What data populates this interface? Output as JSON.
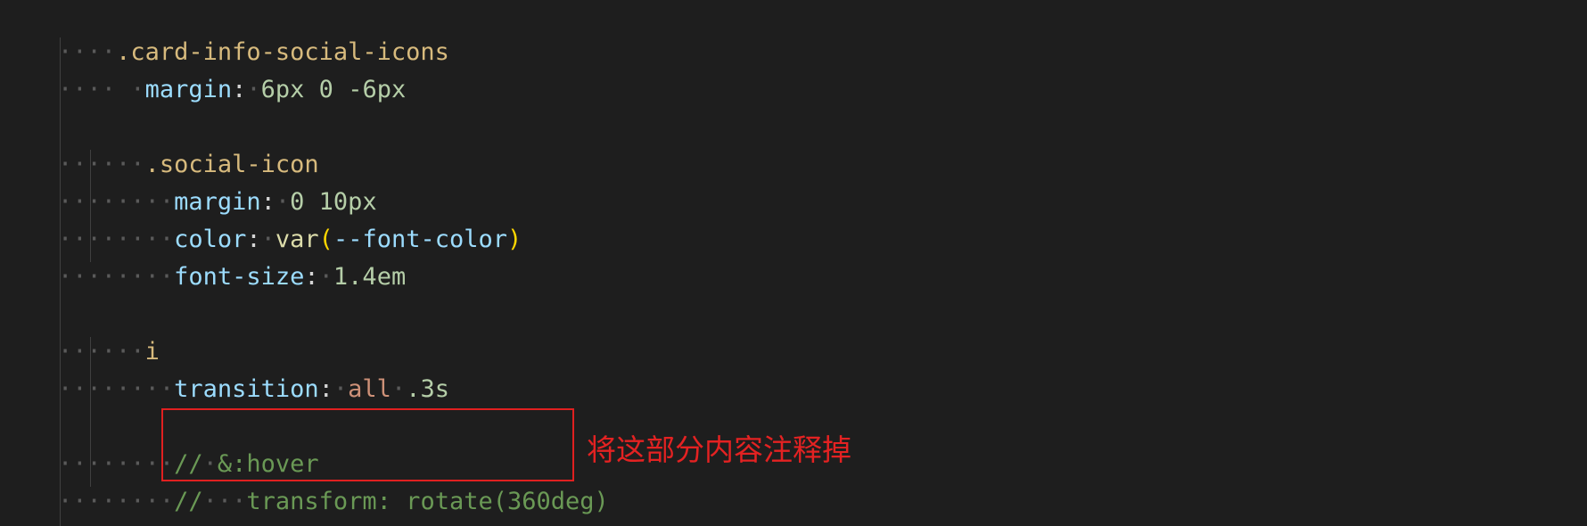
{
  "code": {
    "line1": {
      "selector": ".card-info-social-icons"
    },
    "line2": {
      "prop": "margin",
      "colon": ":",
      "values": "6px 0 -6px"
    },
    "line4": {
      "selector": ".social-icon"
    },
    "line5": {
      "prop": "margin",
      "colon": ":",
      "values": "0 10px"
    },
    "line6": {
      "prop": "color",
      "colon": ":",
      "fn": "var",
      "open": "(",
      "arg": "--font-color",
      "close": ")"
    },
    "line7": {
      "prop": "font-size",
      "colon": ":",
      "values": "1.4em"
    },
    "line9": {
      "selector": "i"
    },
    "line10": {
      "prop": "transition",
      "colon": ":",
      "kw": "all",
      "values": ".3s"
    },
    "line12": {
      "comment": "//",
      "text": "&:hover"
    },
    "line13": {
      "comment": "//",
      "text": "transform: rotate(360deg)"
    }
  },
  "annotation": {
    "text": "将这部分内容注释掉",
    "color": "#e42222"
  },
  "colors": {
    "background": "#1e1e1e",
    "selector": "#d7ba7d",
    "property": "#9cdcfe",
    "number": "#b5cea8",
    "comment": "#6a9955",
    "function": "#dcdcaa",
    "bracket": "#ffd700"
  }
}
